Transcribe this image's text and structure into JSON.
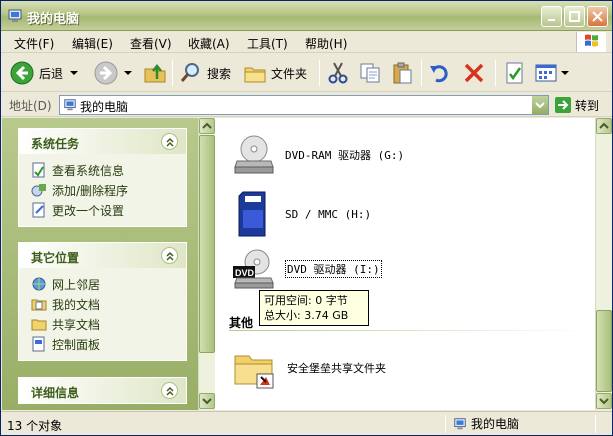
{
  "window": {
    "title": "我的电脑"
  },
  "menu": [
    "文件(F)",
    "编辑(E)",
    "查看(V)",
    "收藏(A)",
    "工具(T)",
    "帮助(H)"
  ],
  "toolbar": {
    "back_label": "后退",
    "search_label": "搜索",
    "folders_label": "文件夹"
  },
  "address": {
    "label": "地址(D)",
    "value": "我的电脑",
    "go_label": "转到"
  },
  "panels": {
    "system_tasks": {
      "title": "系统任务",
      "items": [
        "查看系统信息",
        "添加/删除程序",
        "更改一个设置"
      ]
    },
    "other_places": {
      "title": "其它位置",
      "items": [
        "网上邻居",
        "我的文档",
        "共享文档",
        "控制面板"
      ]
    },
    "details": {
      "title": "详细信息"
    }
  },
  "content": {
    "drives": [
      "DVD-RAM 驱动器 (G:)",
      "SD / MMC (H:)",
      "DVD 驱动器 (I:)"
    ],
    "group_title": "其他",
    "other_items": [
      "安全堡垒共享文件夹"
    ],
    "dvd_badge": "DVD",
    "tooltip": {
      "line1": "可用空间: 0 字节",
      "line2": "总大小: 3.74 GB"
    }
  },
  "status": {
    "left": "13 个对象",
    "right": "我的电脑"
  }
}
